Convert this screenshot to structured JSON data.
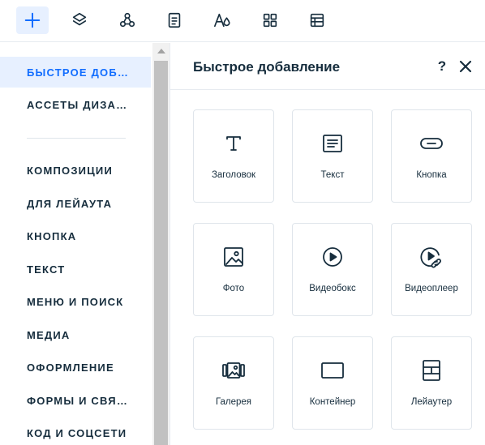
{
  "toolbar": {
    "items": [
      {
        "icon": "plus-icon",
        "active": true
      },
      {
        "icon": "layers-icon"
      },
      {
        "icon": "connections-icon"
      },
      {
        "icon": "page-icon"
      },
      {
        "icon": "typography-icon"
      },
      {
        "icon": "apps-grid-icon"
      },
      {
        "icon": "table-icon"
      }
    ]
  },
  "categories": {
    "items": [
      {
        "label": "БЫСТРОЕ ДОБ…",
        "active": true
      },
      {
        "label": "АССЕТЫ ДИЗА…"
      },
      {
        "label": "КОМПОЗИЦИИ"
      },
      {
        "label": "ДЛЯ ЛЕЙАУТА"
      },
      {
        "label": "КНОПКА"
      },
      {
        "label": "ТЕКСТ"
      },
      {
        "label": "МЕНЮ И ПОИСК"
      },
      {
        "label": "МЕДИА"
      },
      {
        "label": "ОФОРМЛЕНИЕ"
      },
      {
        "label": "ФОРМЫ И СВЯ…"
      },
      {
        "label": "КОД И СОЦСЕТИ"
      }
    ]
  },
  "panel": {
    "title": "Быстрое добавление",
    "help_label": "?",
    "tiles": [
      {
        "label": "Заголовок",
        "icon": "heading-icon"
      },
      {
        "label": "Текст",
        "icon": "text-icon"
      },
      {
        "label": "Кнопка",
        "icon": "button-icon"
      },
      {
        "label": "Фото",
        "icon": "image-icon"
      },
      {
        "label": "Видеобокс",
        "icon": "play-icon"
      },
      {
        "label": "Видеоплеер",
        "icon": "video-link-icon"
      },
      {
        "label": "Галерея",
        "icon": "gallery-icon"
      },
      {
        "label": "Контейнер",
        "icon": "container-icon"
      },
      {
        "label": "Лейаутер",
        "icon": "layouter-icon"
      }
    ]
  },
  "colors": {
    "accent": "#116dff",
    "active_bg": "#e7f0ff",
    "text": "#162d3d",
    "border": "#dfe5eb"
  }
}
